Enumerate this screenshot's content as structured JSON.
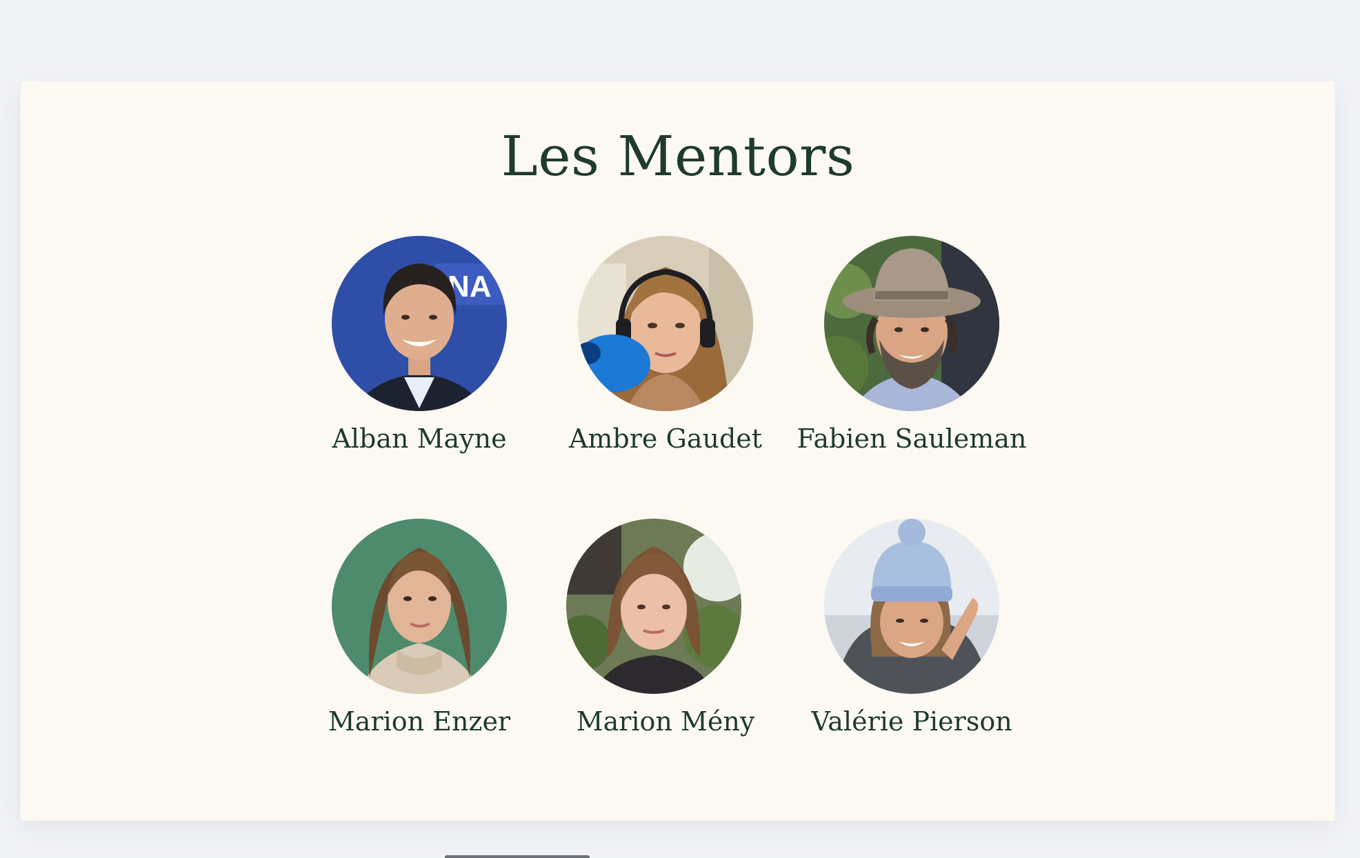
{
  "section": {
    "title": "Les Mentors"
  },
  "mentors": [
    {
      "name": "Alban Mayne",
      "avatar": "portrait-man-blue-backdrop"
    },
    {
      "name": "Ambre Gaudet",
      "avatar": "portrait-woman-headphones-microphone"
    },
    {
      "name": "Fabien Sauleman",
      "avatar": "portrait-man-hat-beard"
    },
    {
      "name": "Marion Enzer",
      "avatar": "portrait-woman-green-backdrop"
    },
    {
      "name": "Marion Mény",
      "avatar": "portrait-woman-brown-hair-plants"
    },
    {
      "name": "Valérie Pierson",
      "avatar": "portrait-woman-knit-beanie"
    }
  ],
  "colors": {
    "page_background": "#f2f3f7",
    "card_background": "#fcf9f3",
    "heading_text": "#1f3a2e"
  }
}
